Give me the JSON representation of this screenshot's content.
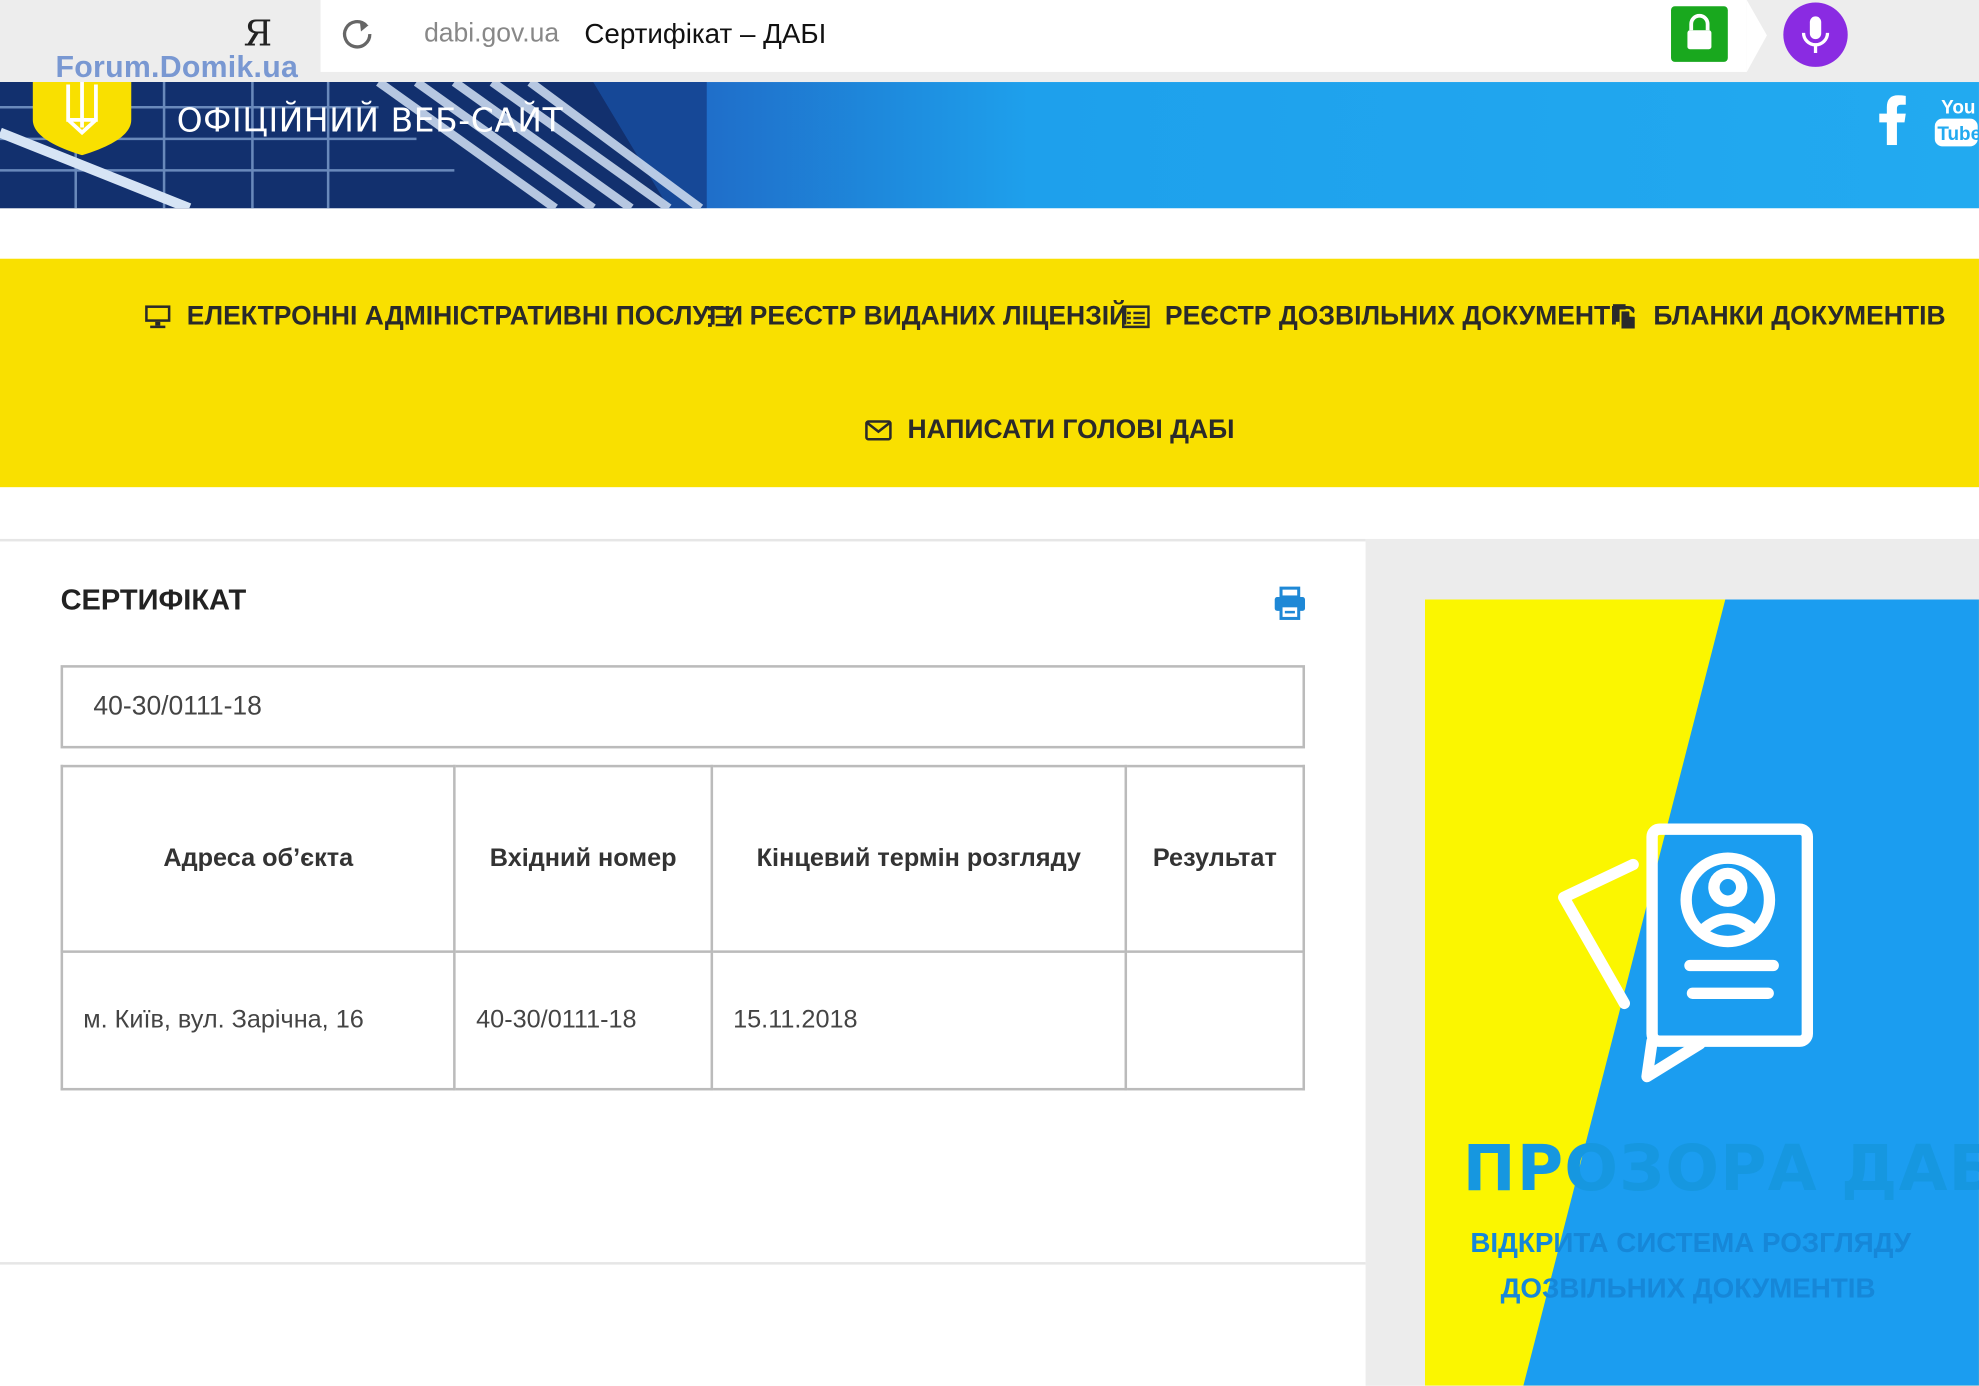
{
  "browser": {
    "yandex_logo": "Я",
    "watermark": "Forum.Domik.ua",
    "url_domain": "dabi.gov.ua",
    "page_title": "Сертифікат – ДАБІ"
  },
  "header": {
    "site_title": "ОФІЦІЙНИЙ ВЕБ-САЙТ",
    "social": [
      "facebook",
      "youtube"
    ],
    "youtube_label_top": "You",
    "youtube_label_bottom": "Tube"
  },
  "nav": {
    "items": [
      {
        "label": "ЕЛЕКТРОННІ АДМІНІСТРАТИВНІ ПОСЛУГИ",
        "icon": "monitor-icon"
      },
      {
        "label": "РЕЄСТР ВИДАНИХ ЛІЦЕНЗІЙ",
        "icon": "list-icon"
      },
      {
        "label": "РЕЄСТР ДОЗВІЛЬНИХ ДОКУМЕНТІВ",
        "icon": "document-list-icon"
      },
      {
        "label": "БЛАНКИ ДОКУМЕНТІВ",
        "icon": "copy-docs-icon"
      },
      {
        "label": "НАПИСАТИ ГОЛОВІ ДАБІ",
        "icon": "envelope-icon"
      }
    ]
  },
  "certificate": {
    "title": "СЕРТИФІКАТ",
    "search_value": "40-30/0111-18",
    "columns": [
      "Адреса об’єкта",
      "Вхідний номер",
      "Кінцевий термін розгляду",
      "Результат"
    ],
    "rows": [
      [
        "м. Київ, вул. Зарічна, 16",
        "40-30/0111-18",
        "15.11.2018",
        ""
      ]
    ]
  },
  "promo": {
    "title": "ПРОЗОРА ДАБІ",
    "subtitle_line1": "ВІДКРИТА СИСТЕМА РОЗГЛЯДУ",
    "subtitle_line2": "ДОЗВІЛЬНИХ ДОКУМЕНТІВ"
  },
  "colors": {
    "nav_yellow": "#f9e000",
    "banner_blue": "#22aaf0",
    "lock_green": "#19a81e",
    "mic_purple": "#8a2be2",
    "promo_title": "#1697e0"
  }
}
